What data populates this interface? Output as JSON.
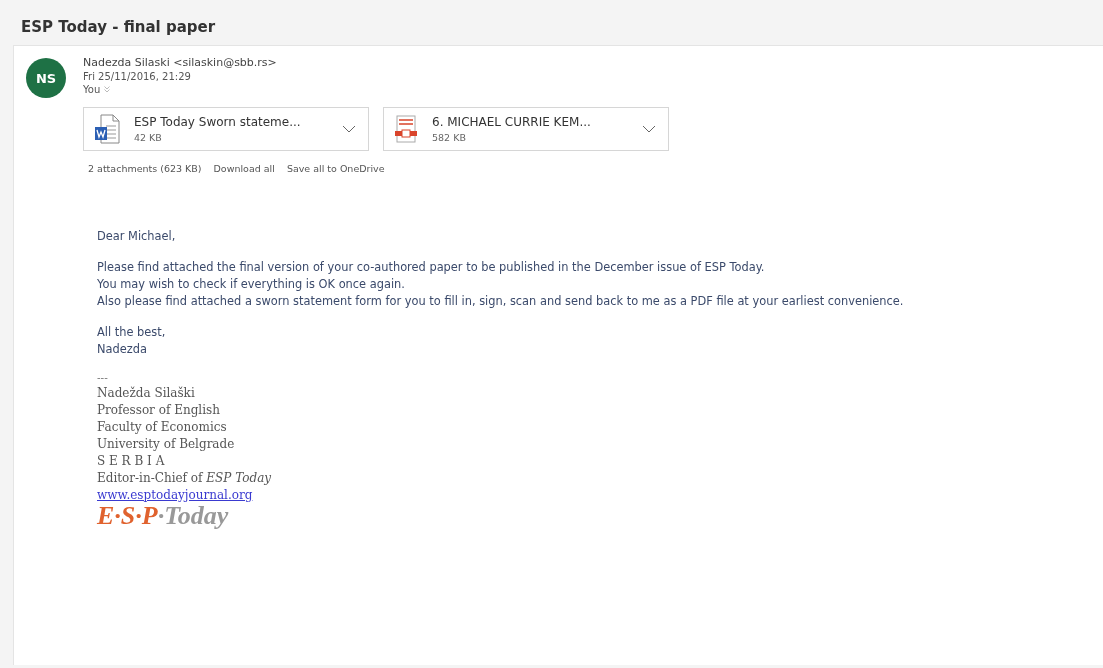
{
  "subject": "ESP Today - final paper",
  "message": {
    "avatar_initials": "NS",
    "sender": "Nadezda Silaski <silaskin@sbb.rs>",
    "date": "Fri 25/11/2016, 21:29",
    "recipient": "You",
    "attachments": [
      {
        "kind": "word",
        "name": "ESP Today Sworn stateme...",
        "size": "42 KB"
      },
      {
        "kind": "pdf",
        "name": "6. MICHAEL CURRIE KEM...",
        "size": "582 KB"
      }
    ],
    "attachment_summary": "2 attachments (623 KB)",
    "actions": [
      "Download all",
      "Save all to OneDrive"
    ],
    "body": [
      [
        "Dear Michael,"
      ],
      [
        "Please find attached the final version of your co-authored paper to be published in the December issue of ESP Today.",
        "You may wish to check if everything is OK once again.",
        "Also please find attached a sworn statement form for you to fill in, sign, scan and send back to me as a PDF file at your earliest convenience."
      ],
      [
        "All the best,",
        "Nadezda"
      ]
    ],
    "signature": {
      "separator": "---",
      "lines": [
        "Nadežda Silaški",
        "Professor of English",
        "Faculty of Economics",
        "University of Belgrade",
        "S E R B I A",
        "Editor-in-Chief of *ESP Today*"
      ],
      "link": "www.esptodayjournal.org",
      "logo": [
        "E·S·P",
        "·Today"
      ]
    }
  }
}
